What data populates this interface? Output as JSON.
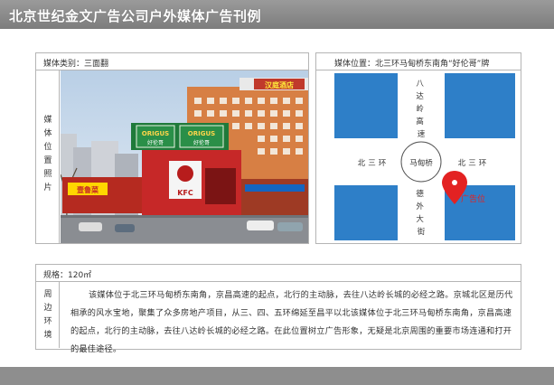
{
  "header": {
    "title": "北京世纪金文广告公司户外媒体广告刊例"
  },
  "media": {
    "type_label": "媒体类别：三面翻",
    "photo_label_chars": [
      "媒",
      "体",
      "位",
      "置",
      "照",
      "片"
    ],
    "photo_signs": {
      "kfc_label": "KFC",
      "origus_label": "ORIGUS",
      "origus_sub": "好伦哥",
      "left_sign": "壹鲁菜"
    }
  },
  "location": {
    "label": "媒体位置：北三环马甸桥东南角“好伦哥”牌",
    "map": {
      "north_road": "八达岭高速",
      "west_road": "北三环",
      "east_road": "北三环",
      "south_road": "德外大街",
      "center": "马甸桥",
      "marker_label": "广告位",
      "road_color": "#2e7fc8",
      "marker_color": "#e32222"
    }
  },
  "spec": {
    "label": "规格：120㎡"
  },
  "surround": {
    "label_chars": [
      "周",
      "边",
      "环",
      "境"
    ],
    "text": "该媒体位于北三环马甸桥东南角，京昌高速的起点，北行的主动脉，去往八达岭长城的必经之路。京城北区是历代相承的风水宝地，聚集了众多房地产项目，从三、四、五环绵延至昌平以北该媒体位于北三环马甸桥东南角，京昌高速的起点，北行的主动脉，去往八达岭长城的必经之路。在此位置树立广告形象，无疑是北京周围的重要市场连通和打开的最佳途径。"
  }
}
